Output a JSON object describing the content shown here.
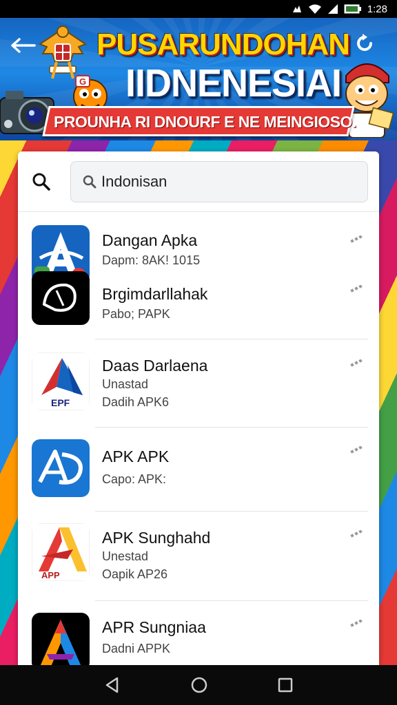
{
  "status_bar": {
    "time": "1:28"
  },
  "banner": {
    "title_line_1": "PUSARUNDOHAN",
    "title_line_2": "IIDNENESIAI",
    "ribbon": "PROUNHA RI DNOURF E NE MEINGIOSO."
  },
  "search": {
    "value": "Indonisan"
  },
  "apps": [
    {
      "name": "Dangan Apka",
      "sub1": "Dapm: 8AK! 1015",
      "sub2": ""
    },
    {
      "name": "Brgimdarllahak",
      "sub1": "Pabo; PAPK",
      "sub2": ""
    },
    {
      "name": "Daas Darlaena",
      "sub1": "Unastad",
      "sub2": "Dadih APK6"
    },
    {
      "name": "APK APK",
      "sub1": "Capo: APK:",
      "sub2": ""
    },
    {
      "name": "APK Sunghahd",
      "sub1": "Unestad",
      "sub2": "Oapik AP26"
    },
    {
      "name": "APR Sungniaa",
      "sub1": "Dadni APPK",
      "sub2": ""
    }
  ],
  "icon_labels": {
    "daas": "EPF",
    "sung": "APP"
  },
  "colors": {
    "accent_blue": "#1e88e5",
    "banner_yellow": "#ffd600",
    "ribbon_red": "#e53935"
  }
}
